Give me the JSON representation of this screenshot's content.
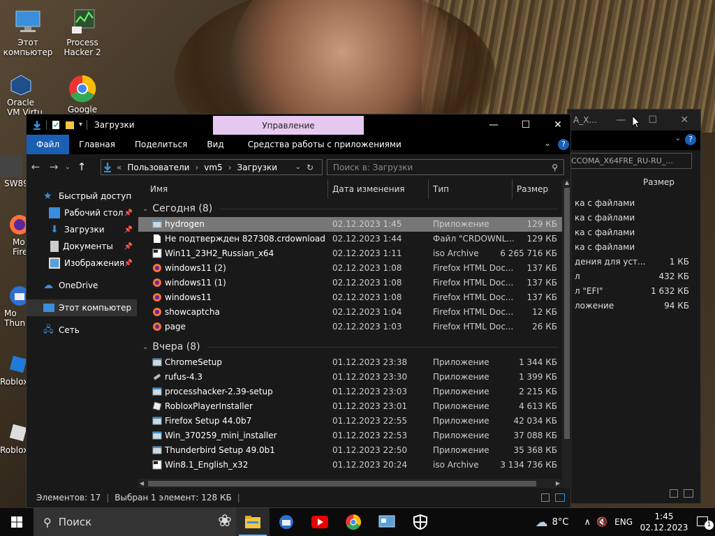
{
  "desktop": {
    "icons": [
      {
        "label": "Этот компьютер"
      },
      {
        "label": "Process Hacker 2"
      },
      {
        "label": "Oracle VM Virtu"
      },
      {
        "label": "Google"
      },
      {
        "label": "SW89"
      },
      {
        "label": "Mo Fire"
      },
      {
        "label": "Mo Thund"
      },
      {
        "label": "Roblox"
      },
      {
        "label": "Roblox"
      }
    ]
  },
  "bg_window": {
    "title_partial": "A_X...",
    "path_partial": "CCOMA_X64FRE_RU-RU_...",
    "col_size": "Размер",
    "rows": [
      {
        "type": "ка с файлами",
        "size": ""
      },
      {
        "type": "ка с файлами",
        "size": ""
      },
      {
        "type": "ка с файлами",
        "size": ""
      },
      {
        "type": "ка с файлами",
        "size": ""
      },
      {
        "type": "дения для уст...",
        "size": "1 КБ"
      },
      {
        "type": "л",
        "size": "432 КБ"
      },
      {
        "type": "л \"EFI\"",
        "size": "1 632 КБ"
      },
      {
        "type": "ложение",
        "size": "94 КБ"
      }
    ]
  },
  "explorer": {
    "title": "Загрузки",
    "manage_tab": "Управление",
    "ribbon": {
      "file": "Файл",
      "home": "Главная",
      "share": "Поделиться",
      "view": "Вид",
      "app_tools": "Средства работы с приложениями"
    },
    "address": {
      "parts": [
        "Пользователи",
        "vm5",
        "Загрузки"
      ],
      "separator": "›",
      "overflow": "«"
    },
    "search_placeholder": "Поиск в: Загрузки",
    "nav": {
      "quick_access": "Быстрый доступ",
      "desktop": "Рабочий стол",
      "downloads": "Загрузки",
      "documents": "Документы",
      "pictures": "Изображения",
      "onedrive": "OneDrive",
      "this_pc": "Этот компьютер",
      "network": "Сеть"
    },
    "columns": {
      "name": "Имя",
      "date": "Дата изменения",
      "type": "Тип",
      "size": "Размер"
    },
    "groups": [
      {
        "label": "Сегодня (8)",
        "files": [
          {
            "name": "hydrogen",
            "date": "02.12.2023 1:45",
            "type": "Приложение",
            "size": "129 КБ",
            "icon": "app-icon"
          },
          {
            "name": "Не подтвержден 827308.crdownload",
            "date": "02.12.2023 1:44",
            "type": "Файл \"CRDOWNL...",
            "size": "129 КБ",
            "icon": "file-icon"
          },
          {
            "name": "Win11_23H2_Russian_x64",
            "date": "02.12.2023 1:11",
            "type": "iso Archive",
            "size": "6 265 716 КБ",
            "icon": "iso-icon"
          },
          {
            "name": "windows11 (2)",
            "date": "02.12.2023 1:08",
            "type": "Firefox HTML Doc...",
            "size": "137 КБ",
            "icon": "firefox-icon"
          },
          {
            "name": "windows11 (1)",
            "date": "02.12.2023 1:08",
            "type": "Firefox HTML Doc...",
            "size": "137 КБ",
            "icon": "firefox-icon"
          },
          {
            "name": "windows11",
            "date": "02.12.2023 1:08",
            "type": "Firefox HTML Doc...",
            "size": "137 КБ",
            "icon": "firefox-icon"
          },
          {
            "name": "showcaptcha",
            "date": "02.12.2023 1:04",
            "type": "Firefox HTML Doc...",
            "size": "12 КБ",
            "icon": "firefox-icon"
          },
          {
            "name": "page",
            "date": "02.12.2023 1:03",
            "type": "Firefox HTML Doc...",
            "size": "26 КБ",
            "icon": "firefox-icon"
          }
        ]
      },
      {
        "label": "Вчера (8)",
        "files": [
          {
            "name": "ChromeSetup",
            "date": "01.12.2023 23:38",
            "type": "Приложение",
            "size": "1 344 КБ",
            "icon": "app-icon"
          },
          {
            "name": "rufus-4.3",
            "date": "01.12.2023 23:30",
            "type": "Приложение",
            "size": "1 399 КБ",
            "icon": "usb-icon"
          },
          {
            "name": "processhacker-2.39-setup",
            "date": "01.12.2023 23:03",
            "type": "Приложение",
            "size": "2 215 КБ",
            "icon": "app-icon"
          },
          {
            "name": "RobloxPlayerInstaller",
            "date": "01.12.2023 23:01",
            "type": "Приложение",
            "size": "4 613 КБ",
            "icon": "roblox-icon"
          },
          {
            "name": "Firefox Setup 44.0b7",
            "date": "01.12.2023 22:55",
            "type": "Приложение",
            "size": "42 034 КБ",
            "icon": "app-icon"
          },
          {
            "name": "Win_370259_mini_installer",
            "date": "01.12.2023 22:53",
            "type": "Приложение",
            "size": "37 088 КБ",
            "icon": "app-icon"
          },
          {
            "name": "Thunderbird Setup 49.0b1",
            "date": "01.12.2023 22:50",
            "type": "Приложение",
            "size": "35 368 КБ",
            "icon": "app-icon"
          },
          {
            "name": "Win8.1_English_x32",
            "date": "01.12.2023 20:24",
            "type": "iso Archive",
            "size": "3 134 736 КБ",
            "icon": "iso-icon"
          }
        ]
      }
    ],
    "status": {
      "count": "Элементов: 17",
      "selected": "Выбран 1 элемент: 128 КБ"
    }
  },
  "taskbar": {
    "search_label": "Поиск",
    "weather": "8°C",
    "lang": "ENG",
    "time": "1:45",
    "date": "02.12.2023",
    "notifications": "1"
  },
  "colors": {
    "accent": "#1a5fb4",
    "manage_tab": "#e6c8f0",
    "selection": "#777777",
    "window_bg": "#191919"
  }
}
